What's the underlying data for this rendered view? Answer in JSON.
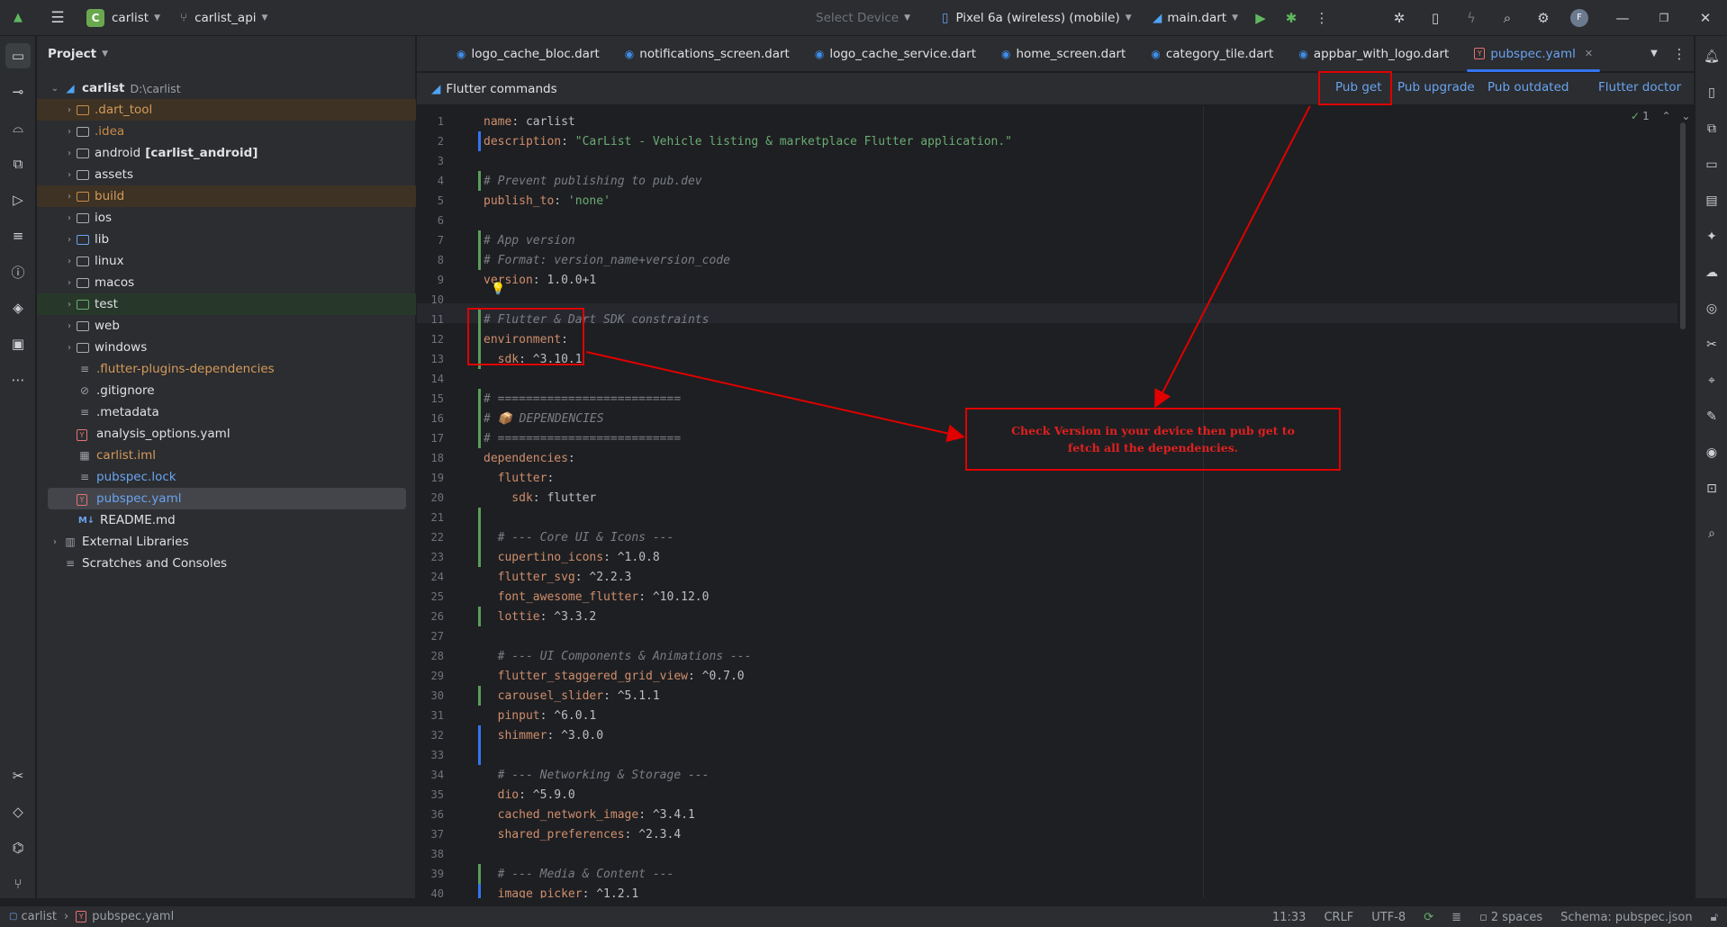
{
  "topbar": {
    "project_badge": "C",
    "project_name": "carlist",
    "branch": "carlist_api",
    "select_device": "Select Device",
    "device": "Pixel 6a (wireless) (mobile)",
    "run_config": "main.dart",
    "avatar_letter": "F"
  },
  "project_panel": {
    "title": "Project",
    "root_name": "carlist",
    "root_path": "D:\\carlist",
    "items": [
      {
        "label": ".dart_tool",
        "suffix": ""
      },
      {
        "label": ".idea",
        "suffix": ""
      },
      {
        "label": "android",
        "suffix": "[carlist_android]"
      },
      {
        "label": "assets",
        "suffix": ""
      },
      {
        "label": "build",
        "suffix": ""
      },
      {
        "label": "ios",
        "suffix": ""
      },
      {
        "label": "lib",
        "suffix": ""
      },
      {
        "label": "linux",
        "suffix": ""
      },
      {
        "label": "macos",
        "suffix": ""
      },
      {
        "label": "test",
        "suffix": ""
      },
      {
        "label": "web",
        "suffix": ""
      },
      {
        "label": "windows",
        "suffix": ""
      },
      {
        "label": ".flutter-plugins-dependencies",
        "suffix": ""
      },
      {
        "label": ".gitignore",
        "suffix": ""
      },
      {
        "label": ".metadata",
        "suffix": ""
      },
      {
        "label": "analysis_options.yaml",
        "suffix": ""
      },
      {
        "label": "carlist.iml",
        "suffix": ""
      },
      {
        "label": "pubspec.lock",
        "suffix": ""
      },
      {
        "label": "pubspec.yaml",
        "suffix": ""
      },
      {
        "label": "README.md",
        "suffix": ""
      },
      {
        "label": "External Libraries",
        "suffix": ""
      },
      {
        "label": "Scratches and Consoles",
        "suffix": ""
      }
    ],
    "md_badge": "M↓"
  },
  "tabs": [
    "logo_cache_bloc.dart",
    "notifications_screen.dart",
    "logo_cache_service.dart",
    "home_screen.dart",
    "category_tile.dart",
    "appbar_with_logo.dart",
    "pubspec.yaml"
  ],
  "commands_bar": {
    "title": "Flutter commands",
    "pub_get": "Pub get",
    "pub_upgrade": "Pub upgrade",
    "pub_outdated": "Pub outdated",
    "flutter_doctor": "Flutter doctor",
    "inspection_count": "1"
  },
  "code_lines": [
    {
      "n": "1",
      "key": "name",
      "val": " carlist",
      "type": "kv"
    },
    {
      "n": "2",
      "key": "description",
      "val": " \"CarList - Vehicle listing & marketplace Flutter application.\"",
      "type": "kvs"
    },
    {
      "n": "3",
      "text": "",
      "type": "blank"
    },
    {
      "n": "4",
      "text": "# Prevent publishing to pub.dev",
      "type": "comment"
    },
    {
      "n": "5",
      "key": "publish_to",
      "val": " 'none'",
      "type": "kvs"
    },
    {
      "n": "6",
      "text": "",
      "type": "blank"
    },
    {
      "n": "7",
      "text": "# App version",
      "type": "comment"
    },
    {
      "n": "8",
      "text": "# Format: version_name+version_code",
      "type": "comment"
    },
    {
      "n": "9",
      "key": "version",
      "val": " 1.0.0+1",
      "type": "kv"
    },
    {
      "n": "10",
      "text": "",
      "type": "blank"
    },
    {
      "n": "11",
      "text": "# Flutter & Dart SDK constraints",
      "type": "comment"
    },
    {
      "n": "12",
      "key": "environment",
      "val": "",
      "type": "kv"
    },
    {
      "n": "13",
      "key": "  sdk",
      "val": " ^3.10.1",
      "type": "kv"
    },
    {
      "n": "14",
      "text": "",
      "type": "blank"
    },
    {
      "n": "15",
      "text": "# ==========================",
      "type": "comment"
    },
    {
      "n": "16",
      "text": "# 📦 DEPENDENCIES",
      "type": "comment"
    },
    {
      "n": "17",
      "text": "# ==========================",
      "type": "comment"
    },
    {
      "n": "18",
      "key": "dependencies",
      "val": "",
      "type": "kv"
    },
    {
      "n": "19",
      "key": "  flutter",
      "val": "",
      "type": "kv"
    },
    {
      "n": "20",
      "key": "    sdk",
      "val": " flutter",
      "type": "kv"
    },
    {
      "n": "21",
      "text": "",
      "type": "blank"
    },
    {
      "n": "22",
      "text": "  # --- Core UI & Icons ---",
      "type": "comment"
    },
    {
      "n": "23",
      "key": "  cupertino_icons",
      "val": " ^1.0.8",
      "type": "kv"
    },
    {
      "n": "24",
      "key": "  flutter_svg",
      "val": " ^2.2.3",
      "type": "kv"
    },
    {
      "n": "25",
      "key": "  font_awesome_flutter",
      "val": " ^10.12.0",
      "type": "kv"
    },
    {
      "n": "26",
      "key": "  lottie",
      "val": " ^3.3.2",
      "type": "kv"
    },
    {
      "n": "27",
      "text": "",
      "type": "blank"
    },
    {
      "n": "28",
      "text": "  # --- UI Components & Animations ---",
      "type": "comment"
    },
    {
      "n": "29",
      "key": "  flutter_staggered_grid_view",
      "val": " ^0.7.0",
      "type": "kv"
    },
    {
      "n": "30",
      "key": "  carousel_slider",
      "val": " ^5.1.1",
      "type": "kv"
    },
    {
      "n": "31",
      "key": "  pinput",
      "val": " ^6.0.1",
      "type": "kv"
    },
    {
      "n": "32",
      "key": "  shimmer",
      "val": " ^3.0.0",
      "type": "kv"
    },
    {
      "n": "33",
      "text": "",
      "type": "blank"
    },
    {
      "n": "34",
      "text": "  # --- Networking & Storage ---",
      "type": "comment"
    },
    {
      "n": "35",
      "key": "  dio",
      "val": " ^5.9.0",
      "type": "kv"
    },
    {
      "n": "36",
      "key": "  cached_network_image",
      "val": " ^3.4.1",
      "type": "kv"
    },
    {
      "n": "37",
      "key": "  shared_preferences",
      "val": " ^2.3.4",
      "type": "kv"
    },
    {
      "n": "38",
      "text": "",
      "type": "blank"
    },
    {
      "n": "39",
      "text": "  # --- Media & Content ---",
      "type": "comment"
    },
    {
      "n": "40",
      "key": "  image_picker",
      "val": " ^1.2.1",
      "type": "kv"
    }
  ],
  "annotation": {
    "line1": "Check Version in your device then pub get to",
    "line2": "fetch all the dependencies.",
    "color": "#e00000"
  },
  "statusbar": {
    "project": "carlist",
    "file": "pubspec.yaml",
    "position": "11:33",
    "line_sep": "CRLF",
    "encoding": "UTF-8",
    "indent": "2 spaces",
    "schema": "Schema: pubspec.json"
  },
  "colors": {
    "accent": "#3574f0",
    "link": "#6aa3f0",
    "background": "#1e1f22",
    "panel": "#2b2d30"
  }
}
